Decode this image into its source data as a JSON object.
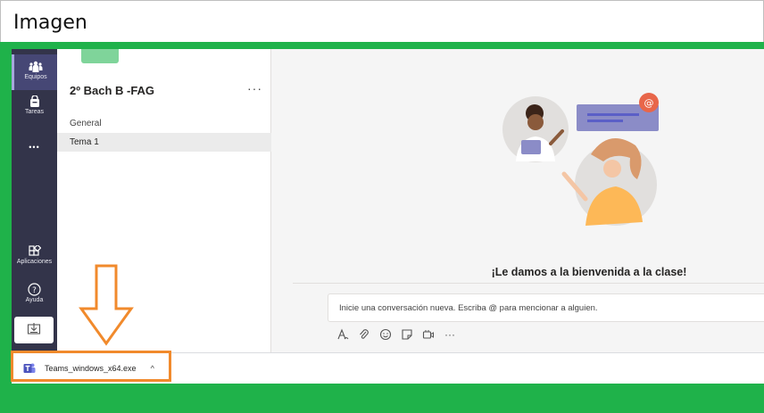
{
  "caption": {
    "title": "Imagen"
  },
  "rail": {
    "teams_label": "Equipos",
    "tasks_label": "Tareas",
    "more_label": "•••",
    "apps_label": "Aplicaciones",
    "help_label": "Ayuda",
    "active_color": "#464775"
  },
  "team": {
    "name": "2º Bach B -FAG",
    "more": "···",
    "channels": [
      {
        "label": "General",
        "selected": false
      },
      {
        "label": "Tema 1",
        "selected": true
      }
    ]
  },
  "main": {
    "welcome": "¡Le damos a la bienvenida a la clase!",
    "compose_placeholder": "Inicie una conversación nueva. Escriba @ para mencionar a alguien.",
    "more_tools": "···",
    "tool_icons": [
      "format-icon",
      "attach-icon",
      "emoji-icon",
      "sticker-icon",
      "meet-icon",
      "more-icon"
    ]
  },
  "download": {
    "file_name": "Teams_windows_x64.exe",
    "chevron": "^"
  },
  "colors": {
    "frame_green": "#1fb24a",
    "annotation_orange": "#f18a2c",
    "rail_bg": "#33344a"
  }
}
